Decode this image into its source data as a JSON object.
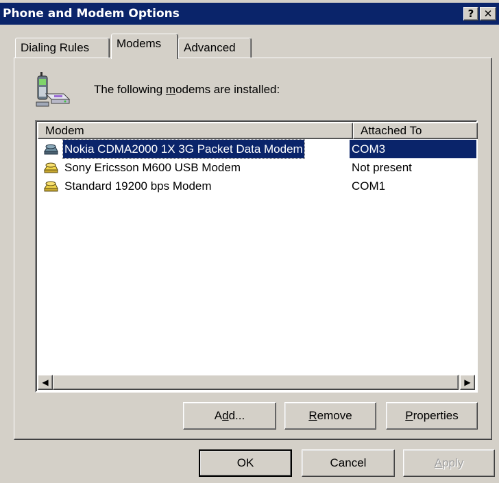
{
  "window": {
    "title": "Phone and Modem Options",
    "help_glyph": "?",
    "close_glyph": "✕"
  },
  "tabs": [
    {
      "label": "Dialing Rules"
    },
    {
      "label": "Modems"
    },
    {
      "label": "Advanced"
    }
  ],
  "panel": {
    "info_pre": "The following ",
    "info_underlined": "m",
    "info_post": "odems are  installed:"
  },
  "list": {
    "headers": {
      "modem": "Modem",
      "attached": "Attached To"
    },
    "rows": [
      {
        "name": "Nokia CDMA2000 1X 3G Packet Data Modem",
        "attached": "COM3",
        "selected": true
      },
      {
        "name": "Sony Ericsson M600 USB Modem",
        "attached": "Not present",
        "selected": false
      },
      {
        "name": "Standard 19200 bps Modem",
        "attached": "COM1",
        "selected": false
      }
    ],
    "scroll_left_glyph": "◀",
    "scroll_right_glyph": "▶"
  },
  "buttons": {
    "add": {
      "pre": "A",
      "u": "d",
      "post": "d..."
    },
    "remove": {
      "pre": "",
      "u": "R",
      "post": "emove"
    },
    "properties": {
      "pre": "",
      "u": "P",
      "post": "roperties"
    },
    "ok": "OK",
    "cancel": "Cancel",
    "apply": {
      "pre": "",
      "u": "A",
      "post": "pply"
    }
  },
  "colors": {
    "title_bar": "#0a246a",
    "selection": "#0a246a",
    "face": "#d4d0c8"
  }
}
